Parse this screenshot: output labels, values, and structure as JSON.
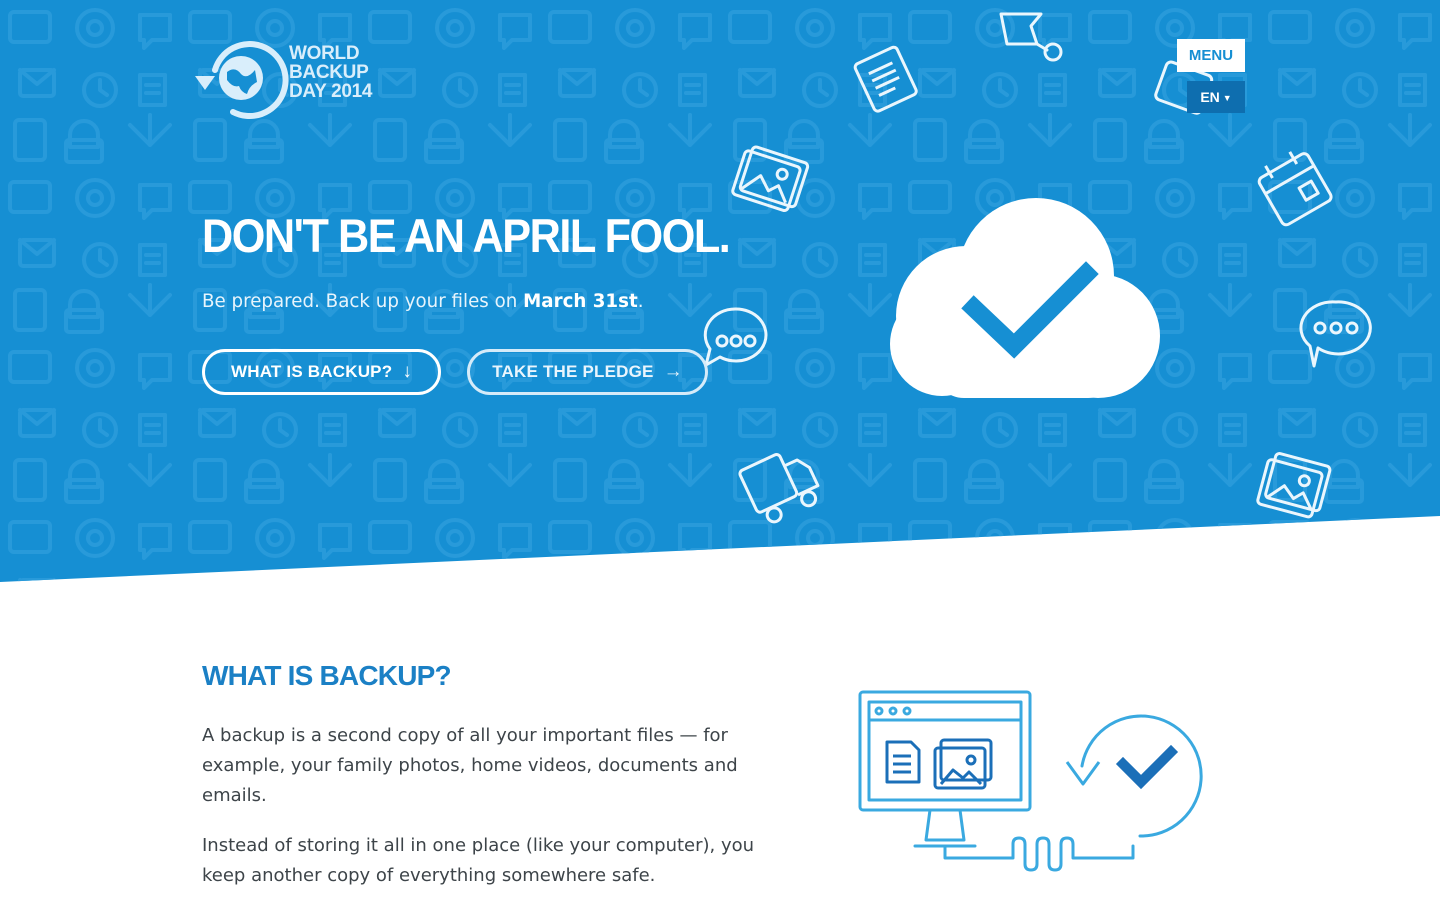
{
  "header": {
    "logo": {
      "line1": "WORLD",
      "line2": "BACKUP",
      "line3": "DAY 2014",
      "icon": "globe-backup-arrow-icon"
    },
    "menu_label": "MENU",
    "language": {
      "selected": "EN",
      "icon": "caret-down-icon"
    }
  },
  "hero": {
    "headline": "DON'T BE AN APRIL FOOL.",
    "subhead_prefix": "Be prepared. Back up your files on ",
    "subhead_date": "March 31st",
    "subhead_suffix": ".",
    "buttons": [
      {
        "label": "WHAT IS BACKUP?",
        "icon": "arrow-down-icon",
        "glyph": "↓"
      },
      {
        "label": "TAKE THE PLEDGE",
        "icon": "arrow-right-icon",
        "glyph": "→"
      }
    ],
    "main_icon": "cloud-check-icon",
    "background_icons": [
      "chat-bubble-icon",
      "photo-icon",
      "document-icon",
      "calendar-icon",
      "truck-icon",
      "tv-icon",
      "video-camera-icon"
    ]
  },
  "what_is_backup": {
    "title": "WHAT IS BACKUP?",
    "paragraphs": [
      "A backup is a second copy of all your important files — for example, your family photos, home videos, documents and emails.",
      "Instead of storing it all in one place (like your computer), you keep another copy of everything somewhere safe."
    ],
    "illustration": "computer-backup-sync-icon"
  },
  "colors": {
    "hero_blue": "#168fd3",
    "heading_blue": "#1b80c5",
    "text_dark": "#3d4449",
    "dropdown_blue": "#0e6eaf"
  }
}
